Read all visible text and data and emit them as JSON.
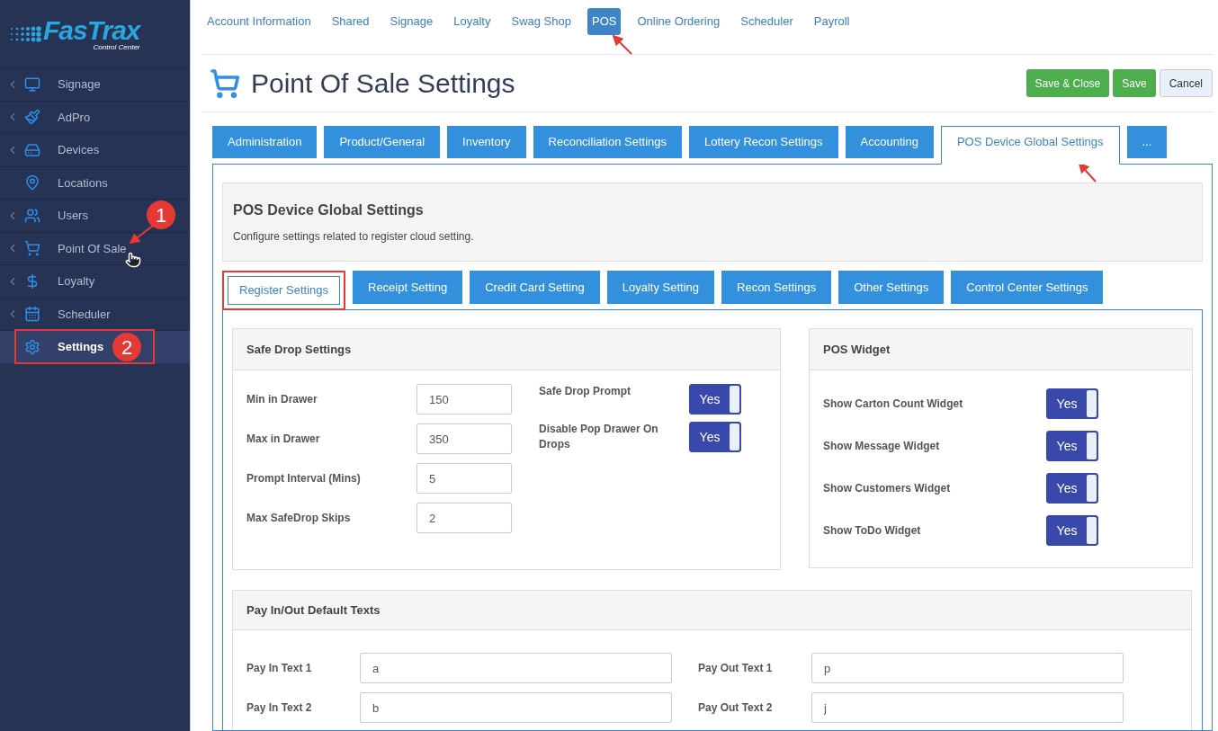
{
  "logo": {
    "name": "FasTrax",
    "tagline": "Control Center"
  },
  "sidebar": {
    "items": [
      {
        "label": "Signage",
        "expandable": true,
        "selected": false,
        "highlighted": false
      },
      {
        "label": "AdPro",
        "expandable": true,
        "selected": false,
        "highlighted": false
      },
      {
        "label": "Devices",
        "expandable": true,
        "selected": false,
        "highlighted": false
      },
      {
        "label": "Locations",
        "expandable": false,
        "selected": false,
        "highlighted": false
      },
      {
        "label": "Users",
        "expandable": true,
        "selected": false,
        "highlighted": false
      },
      {
        "label": "Point Of Sale",
        "expandable": true,
        "selected": false,
        "highlighted": false
      },
      {
        "label": "Loyalty",
        "expandable": true,
        "selected": false,
        "highlighted": false
      },
      {
        "label": "Scheduler",
        "expandable": true,
        "selected": false,
        "highlighted": false
      },
      {
        "label": "Settings",
        "expandable": false,
        "selected": true,
        "highlighted": true
      }
    ]
  },
  "top_nav": [
    {
      "label": "Account Information",
      "selected": false
    },
    {
      "label": "Shared",
      "selected": false
    },
    {
      "label": "Signage",
      "selected": false
    },
    {
      "label": "Loyalty",
      "selected": false
    },
    {
      "label": "Swag Shop",
      "selected": false
    },
    {
      "label": "POS",
      "selected": true
    },
    {
      "label": "Online Ordering",
      "selected": false
    },
    {
      "label": "Scheduler",
      "selected": false
    },
    {
      "label": "Payroll",
      "selected": false
    }
  ],
  "page_title": "Point Of Sale Settings",
  "buttons": [
    {
      "label": "Save & Close",
      "kind": "primary"
    },
    {
      "label": "Save",
      "kind": "primary"
    },
    {
      "label": "Cancel",
      "kind": "default"
    }
  ],
  "tabs": [
    {
      "label": "Administration",
      "selected": false
    },
    {
      "label": "Product/General",
      "selected": false
    },
    {
      "label": "Inventory",
      "selected": false
    },
    {
      "label": "Reconciliation Settings",
      "selected": false
    },
    {
      "label": "Lottery Recon Settings",
      "selected": false
    },
    {
      "label": "Accounting",
      "selected": false
    },
    {
      "label": "POS Device Global Settings",
      "selected": true
    },
    {
      "label": "...",
      "selected": false
    }
  ],
  "section": {
    "title": "POS Device Global Settings",
    "description": "Configure settings related to register cloud setting."
  },
  "sub_tabs": [
    {
      "label": "Register Settings",
      "selected": true,
      "highlighted": true
    },
    {
      "label": "Receipt Setting",
      "selected": false,
      "highlighted": false
    },
    {
      "label": "Credit Card Setting",
      "selected": false,
      "highlighted": false
    },
    {
      "label": "Loyalty Setting",
      "selected": false,
      "highlighted": false
    },
    {
      "label": "Recon Settings",
      "selected": false,
      "highlighted": false
    },
    {
      "label": "Other Settings",
      "selected": false,
      "highlighted": false
    },
    {
      "label": "Control Center Settings",
      "selected": false,
      "highlighted": false
    }
  ],
  "safe_drop": {
    "title": "Safe Drop Settings",
    "fields": [
      {
        "label": "Min in Drawer",
        "value": "150"
      },
      {
        "label": "Max in Drawer",
        "value": "350"
      },
      {
        "label": "Prompt Interval (Mins)",
        "value": "5"
      },
      {
        "label": "Max SafeDrop Skips",
        "value": "2"
      }
    ],
    "toggles": [
      {
        "label": "Safe Drop Prompt",
        "on": true,
        "text": "Yes"
      },
      {
        "label": "Disable Pop Drawer On Drops",
        "on": true,
        "text": "Yes"
      }
    ]
  },
  "pos_widget": {
    "title": "POS Widget",
    "toggles": [
      {
        "label": "Show Carton Count Widget",
        "on": true,
        "text": "Yes"
      },
      {
        "label": "Show Message Widget",
        "on": true,
        "text": "Yes"
      },
      {
        "label": "Show Customers Widget",
        "on": true,
        "text": "Yes"
      },
      {
        "label": "Show ToDo Widget",
        "on": true,
        "text": "Yes"
      }
    ]
  },
  "pay_inout": {
    "title": "Pay In/Out Default Texts",
    "fields": [
      {
        "label": "Pay In Text 1",
        "value": "a"
      },
      {
        "label": "Pay Out Text 1",
        "value": "p"
      },
      {
        "label": "Pay In Text 2",
        "value": "b"
      },
      {
        "label": "Pay Out Text 2",
        "value": "j"
      }
    ]
  },
  "annotations": [
    {
      "number": "1"
    },
    {
      "number": "2"
    }
  ]
}
